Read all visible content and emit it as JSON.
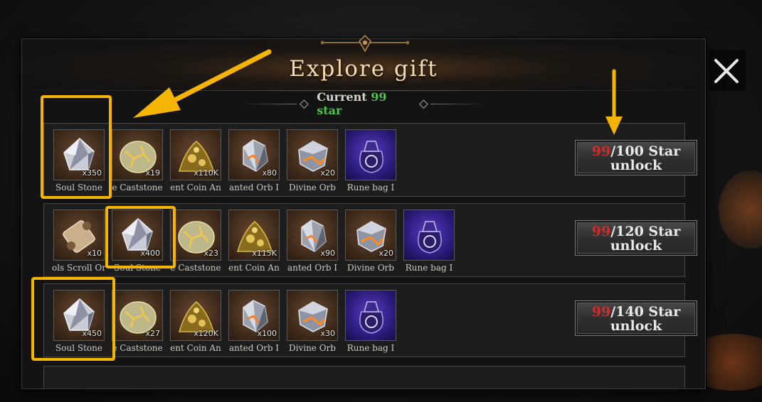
{
  "dialog": {
    "title": "Explore gift",
    "current_label": "Current",
    "current_value": "99 star"
  },
  "rows": [
    {
      "progress_have": "99",
      "progress_rest": "/100 Star",
      "unlock_label": "unlock",
      "items": [
        {
          "name": "Soul Stone",
          "qty": "x350",
          "icon": "soul-stone-icon"
        },
        {
          "name": "e Caststone",
          "qty": "x19",
          "icon": "caststone-icon"
        },
        {
          "name": "ent Coin An",
          "qty": "x110K",
          "icon": "coin-pile-icon"
        },
        {
          "name": "anted Orb I",
          "qty": "x80",
          "icon": "enchanted-orb-icon"
        },
        {
          "name": "Divine Orb",
          "qty": "x20",
          "icon": "divine-orb-icon"
        },
        {
          "name": "Rune bag I",
          "qty": "",
          "icon": "rune-bag-icon"
        }
      ]
    },
    {
      "progress_have": "99",
      "progress_rest": "/120 Star",
      "unlock_label": "unlock",
      "items": [
        {
          "name": "ols Scroll Or",
          "qty": "x10",
          "icon": "scroll-icon"
        },
        {
          "name": "Soul Stone",
          "qty": "x400",
          "icon": "soul-stone-icon"
        },
        {
          "name": "e Caststone",
          "qty": "x23",
          "icon": "caststone-icon"
        },
        {
          "name": "ent Coin An",
          "qty": "x115K",
          "icon": "coin-pile-icon"
        },
        {
          "name": "anted Orb I",
          "qty": "x90",
          "icon": "enchanted-orb-icon"
        },
        {
          "name": "Divine Orb",
          "qty": "x20",
          "icon": "divine-orb-icon"
        },
        {
          "name": "Rune bag I",
          "qty": "",
          "icon": "rune-bag-icon"
        }
      ]
    },
    {
      "progress_have": "99",
      "progress_rest": "/140 Star",
      "unlock_label": "unlock",
      "items": [
        {
          "name": "Soul Stone",
          "qty": "x450",
          "icon": "soul-stone-icon"
        },
        {
          "name": "e Caststone",
          "qty": "x27",
          "icon": "caststone-icon"
        },
        {
          "name": "ent Coin An",
          "qty": "x120K",
          "icon": "coin-pile-icon"
        },
        {
          "name": "anted Orb I",
          "qty": "x100",
          "icon": "enchanted-orb-icon"
        },
        {
          "name": "Divine Orb",
          "qty": "x30",
          "icon": "divine-orb-icon"
        },
        {
          "name": "Rune bag I",
          "qty": "",
          "icon": "rune-bag-icon"
        }
      ]
    }
  ],
  "close_button": {
    "icon": "close-icon"
  },
  "colors": {
    "title": "#f3dcb2",
    "star_value": "#4fc24f",
    "progress_have": "#d42a2a",
    "highlight": "#f4b400"
  }
}
